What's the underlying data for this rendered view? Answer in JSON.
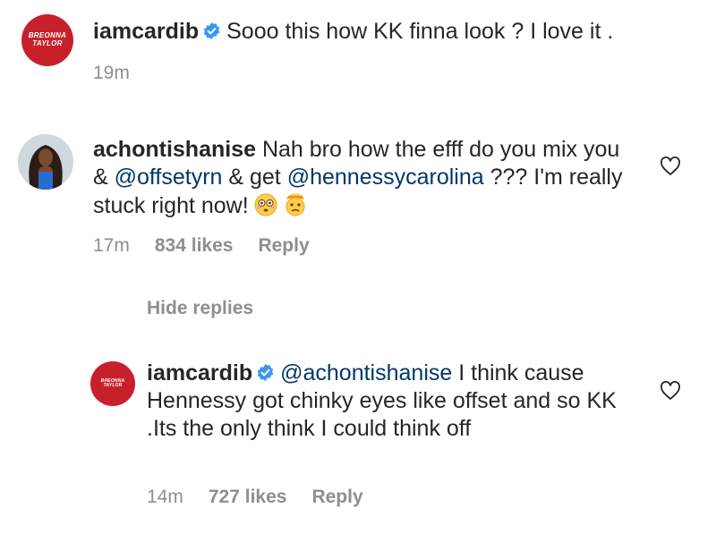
{
  "caption": {
    "avatar_text": [
      "BREONNA",
      "TAYLOR"
    ],
    "username": "iamcardib",
    "text": "Sooo this how KK finna look ? I love it .",
    "time": "19m"
  },
  "comment": {
    "username": "achontishanise",
    "text_part1": "Nah bro how the efff do you mix you & ",
    "mention1": "@offsetyrn",
    "text_part2": " & get ",
    "mention2": "@hennessycarolina",
    "text_part3": " ??? I'm really stuck right now!",
    "time": "17m",
    "likes": "834 likes",
    "reply_label": "Reply"
  },
  "hide_replies_label": "Hide replies",
  "reply": {
    "avatar_text": [
      "BREONNA",
      "TAYLOR"
    ],
    "username": "iamcardib",
    "mention": "@achontishanise",
    "text": " I think cause Hennessy got chinky eyes like offset and so KK .Its the only think I could think off",
    "time": "14m",
    "likes": "727 likes",
    "reply_label": "Reply"
  },
  "colors": {
    "avatar_red": "#c8202a",
    "verified_blue": "#3897f0",
    "mention_blue": "#00376b",
    "meta_gray": "#8e8e8e"
  },
  "icons": [
    "verified-badge-icon",
    "heart-icon",
    "flushed-face-emoji",
    "exploding-head-emoji"
  ]
}
